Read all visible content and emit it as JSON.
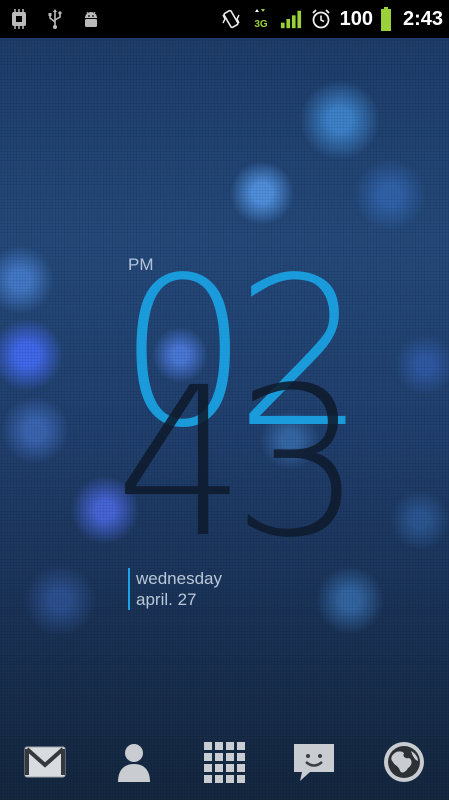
{
  "status_bar": {
    "left_icons": [
      "processor-icon",
      "usb-icon",
      "android-debug-icon"
    ],
    "right_icons": [
      "vibrate-icon",
      "network-3g-icon",
      "signal-icon",
      "alarm-icon",
      "battery-icon"
    ],
    "network_type": "3G",
    "battery_percent": "100",
    "time": "2:43"
  },
  "clock_widget": {
    "ampm": "PM",
    "hour": "02",
    "minute": "43",
    "weekday": "wednesday",
    "date": "april. 27",
    "hour_color": "#1aa5e6",
    "minute_color": "#0f1b2e"
  },
  "dock": {
    "items": [
      "gmail-icon",
      "contacts-icon",
      "app-drawer-icon",
      "messaging-icon",
      "browser-icon"
    ]
  }
}
